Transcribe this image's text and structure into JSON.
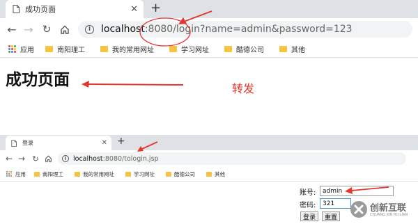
{
  "top": {
    "tab_title": "成功页面",
    "new_tab": "+",
    "url_host": "localhost",
    "url_rest": ":8080/login?name=admin&password=123",
    "bookmarks": [
      "应用",
      "南阳理工",
      "我的常用网址",
      "学习网址",
      "酷德公司",
      "其他"
    ],
    "heading": "成功页面",
    "annotation": "转发"
  },
  "bottom": {
    "tab_title": "登录",
    "new_tab": "+",
    "url_host": "localhost",
    "url_rest": ":8080/tologin.jsp",
    "bookmarks": [
      "应用",
      "南阳理工",
      "我的常用网址",
      "学习网址",
      "酷德公司",
      "其他"
    ]
  },
  "form": {
    "account_label": "账号:",
    "account_value": "admin",
    "password_label": "密码:",
    "password_value": "321",
    "login_button": "登录",
    "reset_button": "重置"
  },
  "watermark": {
    "cn": "创新互联",
    "en": "CHUANG XIN HU LIAN"
  },
  "icons": {
    "back": "back-arrow-icon",
    "forward": "forward-arrow-icon",
    "reload": "reload-icon",
    "home": "home-icon",
    "info": "info-icon",
    "folder": "folder-icon",
    "apps": "apps-grid-icon",
    "close": "close-icon",
    "page": "page-icon"
  },
  "colors": {
    "annotation_red": "#e5352e",
    "tab_strip": "#dee1e6",
    "omnibox": "#f1f3f4",
    "folder": "#f6c343"
  }
}
